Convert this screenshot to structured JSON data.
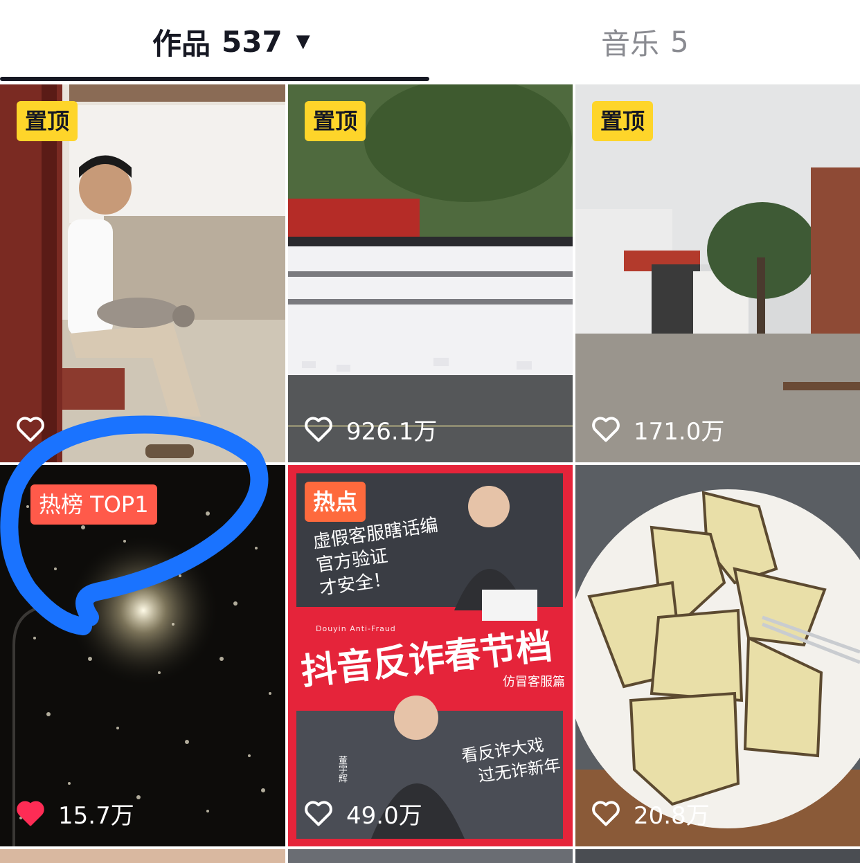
{
  "tabs": {
    "works": {
      "label": "作品",
      "count": "537",
      "caret": "▼"
    },
    "music": {
      "label": "音乐",
      "count": "5"
    }
  },
  "grid": {
    "items": [
      {
        "badge": "置顶",
        "likes": ""
      },
      {
        "badge": "置顶",
        "likes": "926.1万"
      },
      {
        "badge": "置顶",
        "likes": "171.0万"
      },
      {
        "badge": "热榜 TOP1",
        "likes": "15.7万",
        "liked": true
      },
      {
        "badge": "热点",
        "likes": "49.0万",
        "overlay": {
          "title": "抖音反诈春节档",
          "subtitle": "仿冒客服篇",
          "en": "Douyin Anti-Fraud",
          "quote1": "虚假客服瞎话编",
          "quote2": "官方验证",
          "quote3": "才安全！",
          "slogan1": "看反诈大戏",
          "slogan2": "过无诈新年",
          "name": "董宇辉"
        }
      },
      {
        "badge": "",
        "likes": "20.8万"
      }
    ]
  },
  "colors": {
    "pin_badge": "#fed52a",
    "hot_badge": "#fe6a3d",
    "liked_heart": "#fe2c55",
    "annotation": "#1a73ff"
  }
}
